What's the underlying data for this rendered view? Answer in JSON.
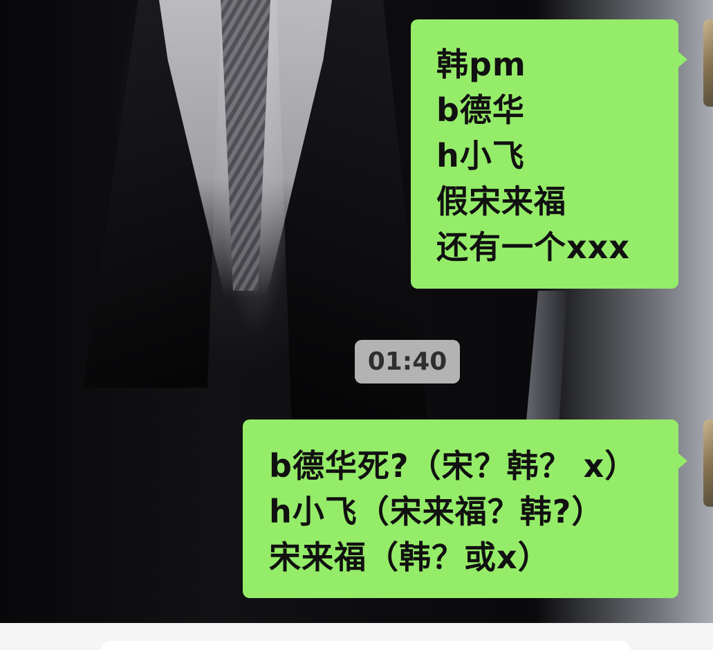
{
  "messages": [
    {
      "sender": "me",
      "lines": [
        "韩pm",
        "b德华",
        "h小飞",
        "假宋来福",
        "还有一个xxx"
      ]
    },
    {
      "sender": "me",
      "lines": [
        "b德华死?（宋？韩？ x）",
        "h小飞（宋来福？韩?）",
        "宋来福（韩？或x）"
      ]
    }
  ],
  "timestamp": "01:40",
  "colors": {
    "bubble_outgoing": "#95ec69",
    "timestamp_bg": "#b3b3b3",
    "input_bar_bg": "#f5f5f5"
  },
  "input_bar": {
    "placeholder": ""
  }
}
